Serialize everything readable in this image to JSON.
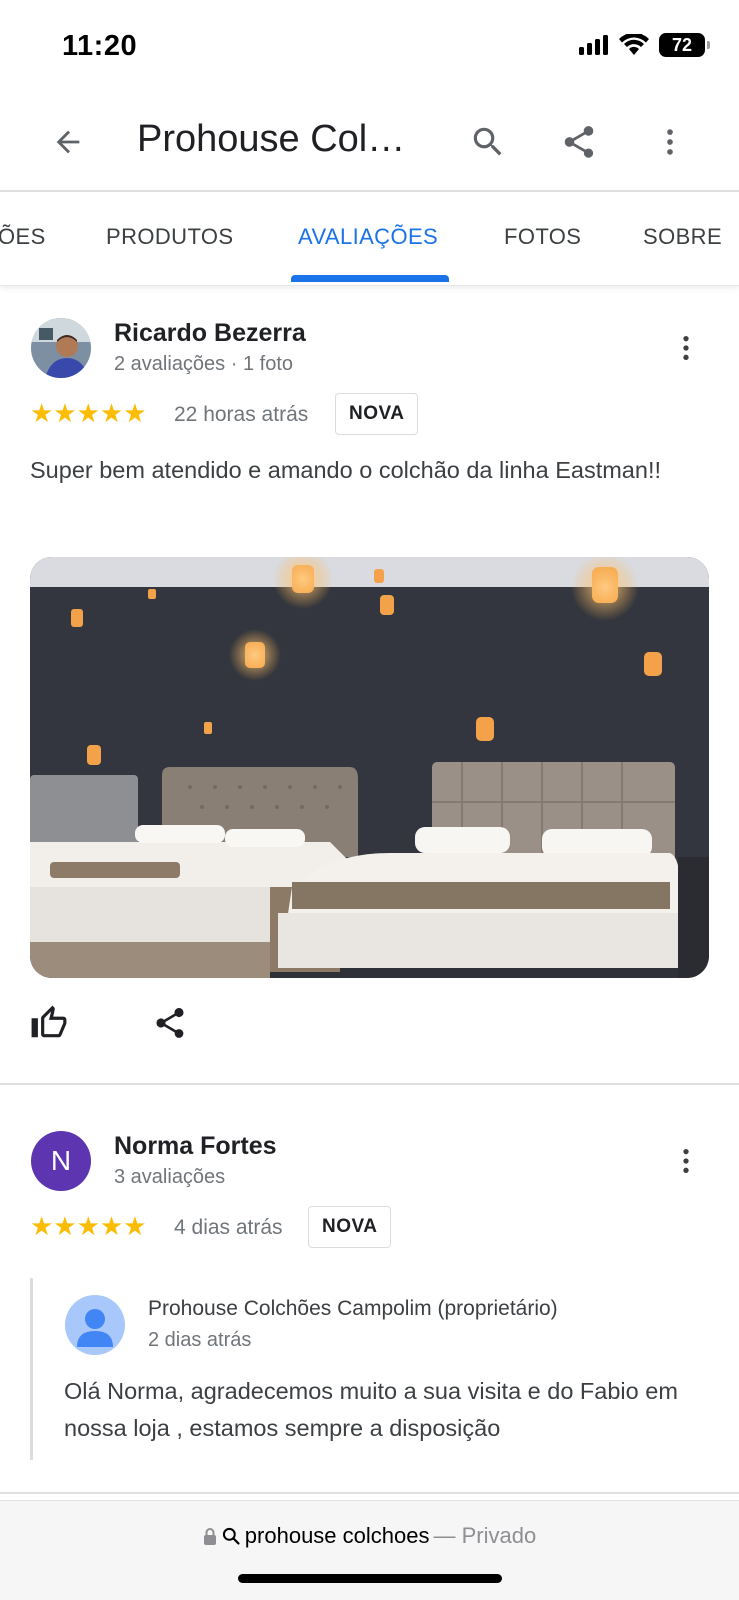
{
  "status_bar": {
    "time": "11:20",
    "battery": "72"
  },
  "app_bar": {
    "title": "Prohouse Col…"
  },
  "tabs": [
    {
      "label": "ÕES"
    },
    {
      "label": "PRODUTOS"
    },
    {
      "label": "AVALIAÇÕES",
      "active": true
    },
    {
      "label": "FOTOS"
    },
    {
      "label": "SOBRE"
    }
  ],
  "reviews": [
    {
      "name": "Ricardo Bezerra",
      "meta": "2 avaliações · 1 foto",
      "stars": "★★★★★",
      "rating": 5,
      "time": "22 horas atrás",
      "badge": "NOVA",
      "text": "Super bem atendido e amando o colchão da linha Eastman!!"
    },
    {
      "name": "Norma Fortes",
      "avatar_letter": "N",
      "meta": "3 avaliações",
      "stars": "★★★★★",
      "rating": 5,
      "time": "4 dias atrás",
      "badge": "NOVA",
      "reply": {
        "name": "Prohouse Colchões Campolim (proprietário)",
        "time": "2 dias atrás",
        "text": "Olá Norma, agradecemos muito a sua visita e do Fabio em nossa loja , estamos sempre a disposição"
      }
    }
  ],
  "address_bar": {
    "query": "prohouse colchoes",
    "suffix": "— Privado"
  },
  "colors": {
    "accent": "#1a73e8",
    "star": "#fbbc04",
    "avatar_n": "#5e35b1"
  }
}
